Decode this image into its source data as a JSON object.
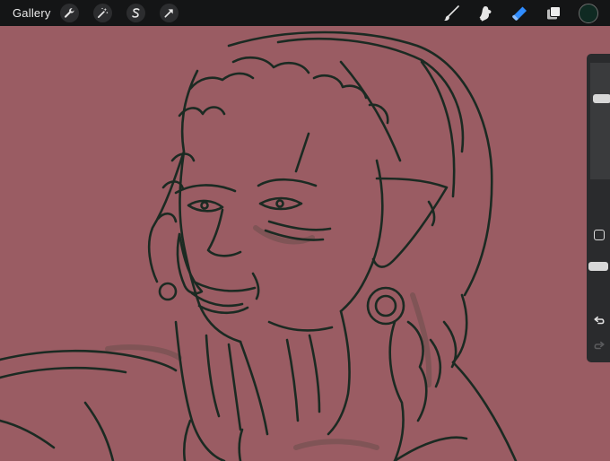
{
  "topbar": {
    "gallery_label": "Gallery",
    "actions_icon": "wrench-icon",
    "adjustments_icon": "magic-wand-icon",
    "selection_icon": "selection-s-icon",
    "transform_icon": "transform-arrow-icon"
  },
  "tools": {
    "brush_icon": "brush-icon",
    "smudge_icon": "smudge-icon",
    "eraser_icon": "eraser-icon",
    "eraser_active": true,
    "layers_icon": "layers-icon",
    "current_color": "#0f2a22",
    "active_tool_color": "#2f8cff"
  },
  "canvas": {
    "background_color": "#9a5c63",
    "line_color": "#1b2a22"
  },
  "sidebar": {
    "brush_size_level": 0.71,
    "opacity_level": 0.45,
    "modify_icon": "square-modify-icon",
    "undo_icon": "undo-arrow-icon",
    "redo_icon": "redo-arrow-icon"
  }
}
